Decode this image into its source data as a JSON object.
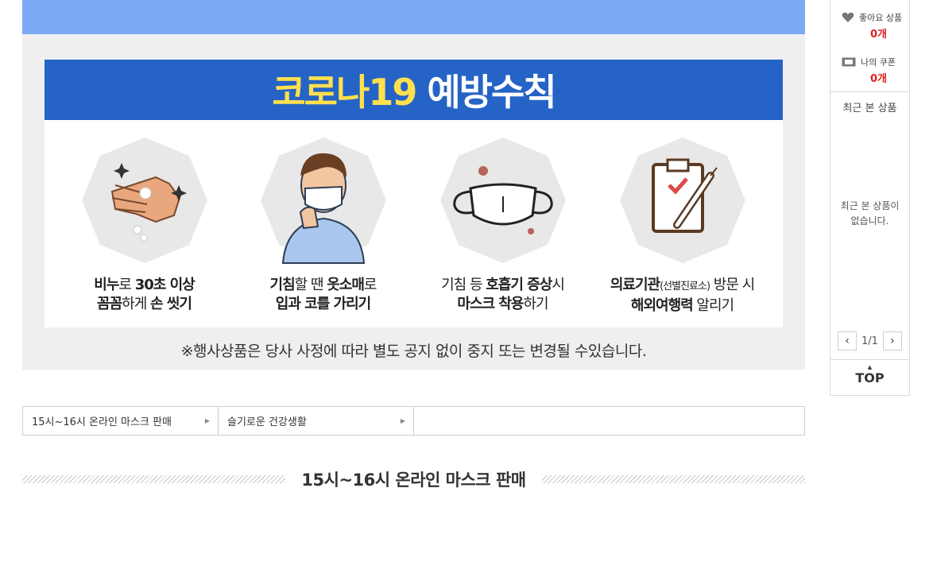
{
  "banner": {
    "title_part1": "코로나19",
    "title_part2": "예방수칙",
    "rules": [
      {
        "icon": "handwash-icon",
        "line1_bold": "비누",
        "line1_rest": "로 ",
        "line1_bold2": "30초 이상",
        "line2_bold": "꼼꼼",
        "line2_rest": "하게 ",
        "line2_bold2": "손 씻기"
      },
      {
        "icon": "cough-person-icon",
        "line1_bold": "기침",
        "line1_rest": "할 땐 ",
        "line1_bold2": "옷소매",
        "line1_rest2": "로",
        "line2_bold": "입과 코를 가리기"
      },
      {
        "icon": "mask-icon",
        "line1_rest": "기침 등 ",
        "line1_bold": "호흡기 증상",
        "line1_rest2": "시",
        "line2_bold": "마스크 착용",
        "line2_rest": "하기"
      },
      {
        "icon": "clipboard-syringe-icon",
        "line1_bold": "의료기관",
        "line1_small": "(선별진료소)",
        "line1_rest": " 방문 시",
        "line2_bold": "해외여행력",
        "line2_rest": " 알리기"
      }
    ],
    "notice": "※행사상품은 당사 사정에 따라 별도 공지 없이 중지 또는 변경될 수있습니다."
  },
  "tabs": [
    {
      "label": "15시~16시 온라인 마스크 판매"
    },
    {
      "label": "슬기로운 건강생활"
    }
  ],
  "section": {
    "title": "15시~16시 온라인 마스크 판매"
  },
  "quickbar": {
    "liked_label": "좋아요 상품",
    "liked_count": "0개",
    "coupon_label": "나의 쿠폰",
    "coupon_count": "0개",
    "recent_title": "최근 본 상품",
    "recent_empty": "최근 본 상품이 없습니다.",
    "pager": "1/1",
    "top_label": "TOP"
  },
  "colors": {
    "top_strip": "#7baaf7",
    "banner_head": "#2563c6",
    "title_yellow": "#ffe14d",
    "count_red": "#e02020"
  }
}
